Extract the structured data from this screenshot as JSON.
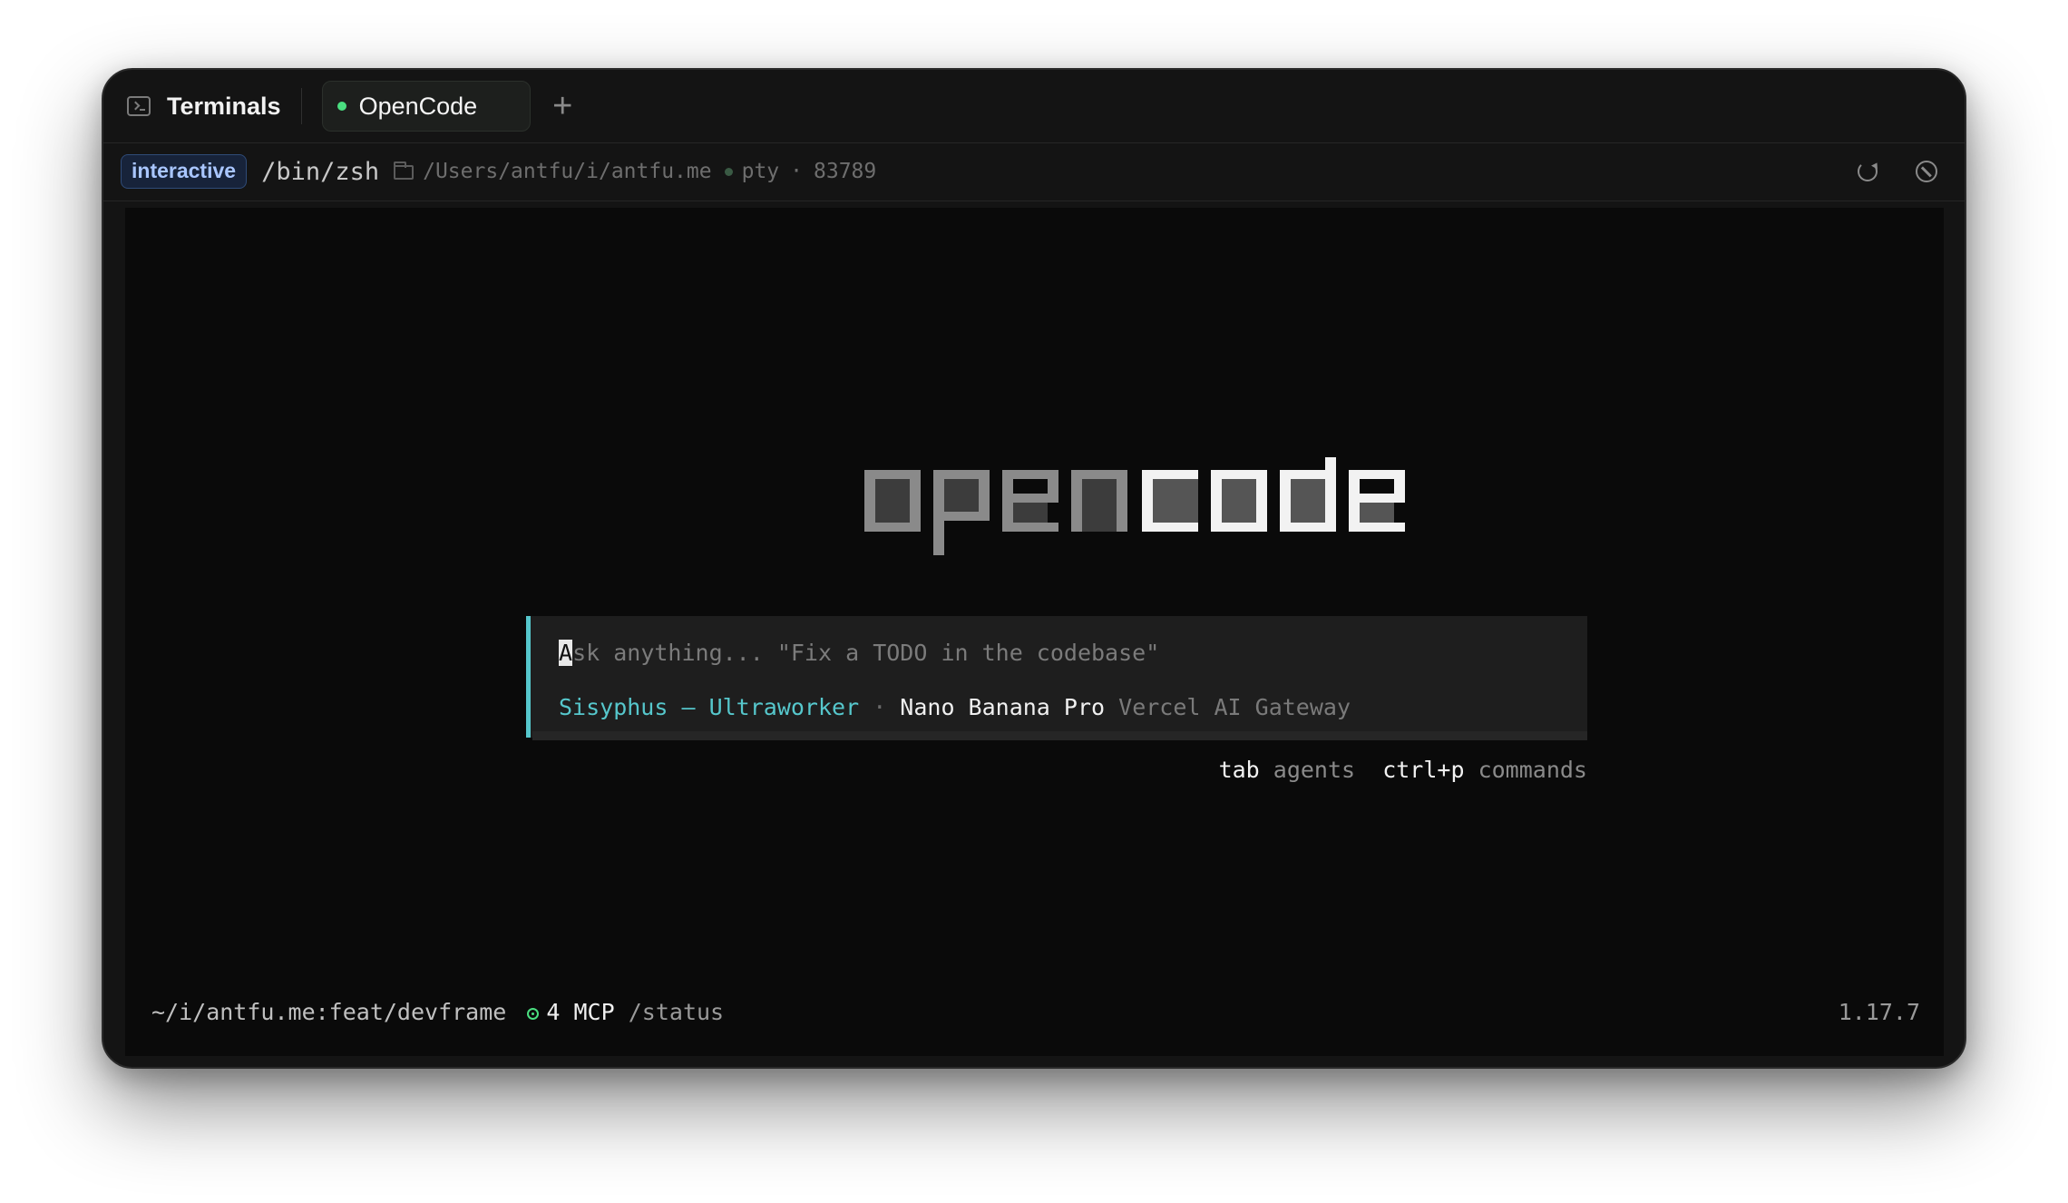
{
  "tabbar": {
    "section_label": "Terminals",
    "active_tab_label": "OpenCode",
    "new_tab_icon": "plus-icon"
  },
  "infobar": {
    "mode_badge": "interactive",
    "shell": "/bin/zsh",
    "cwd": "/Users/antfu/i/antfu.me",
    "pty_label": "pty",
    "pid_separator": "·",
    "pid": "83789"
  },
  "terminal": {
    "logo_text": "opencode",
    "prompt": {
      "cursor_char": "A",
      "placeholder_rest": "sk anything... \"Fix a TODO in the codebase\"",
      "agent": "Sisyphus – Ultraworker",
      "separator": " · ",
      "model": "Nano Banana Pro",
      "provider": "Vercel AI Gateway"
    },
    "hints": [
      {
        "key": "tab",
        "label": "agents"
      },
      {
        "key": "ctrl+p",
        "label": "commands"
      }
    ],
    "status": {
      "path_branch": "~/i/antfu.me:feat/devframe",
      "mcp_count": "4 MCP",
      "status_cmd": "/status",
      "version": "1.17.7"
    }
  },
  "colors": {
    "accent_cyan": "#56c7cc",
    "active_green": "#4ade80",
    "badge_blue": "#a9c6ff"
  }
}
